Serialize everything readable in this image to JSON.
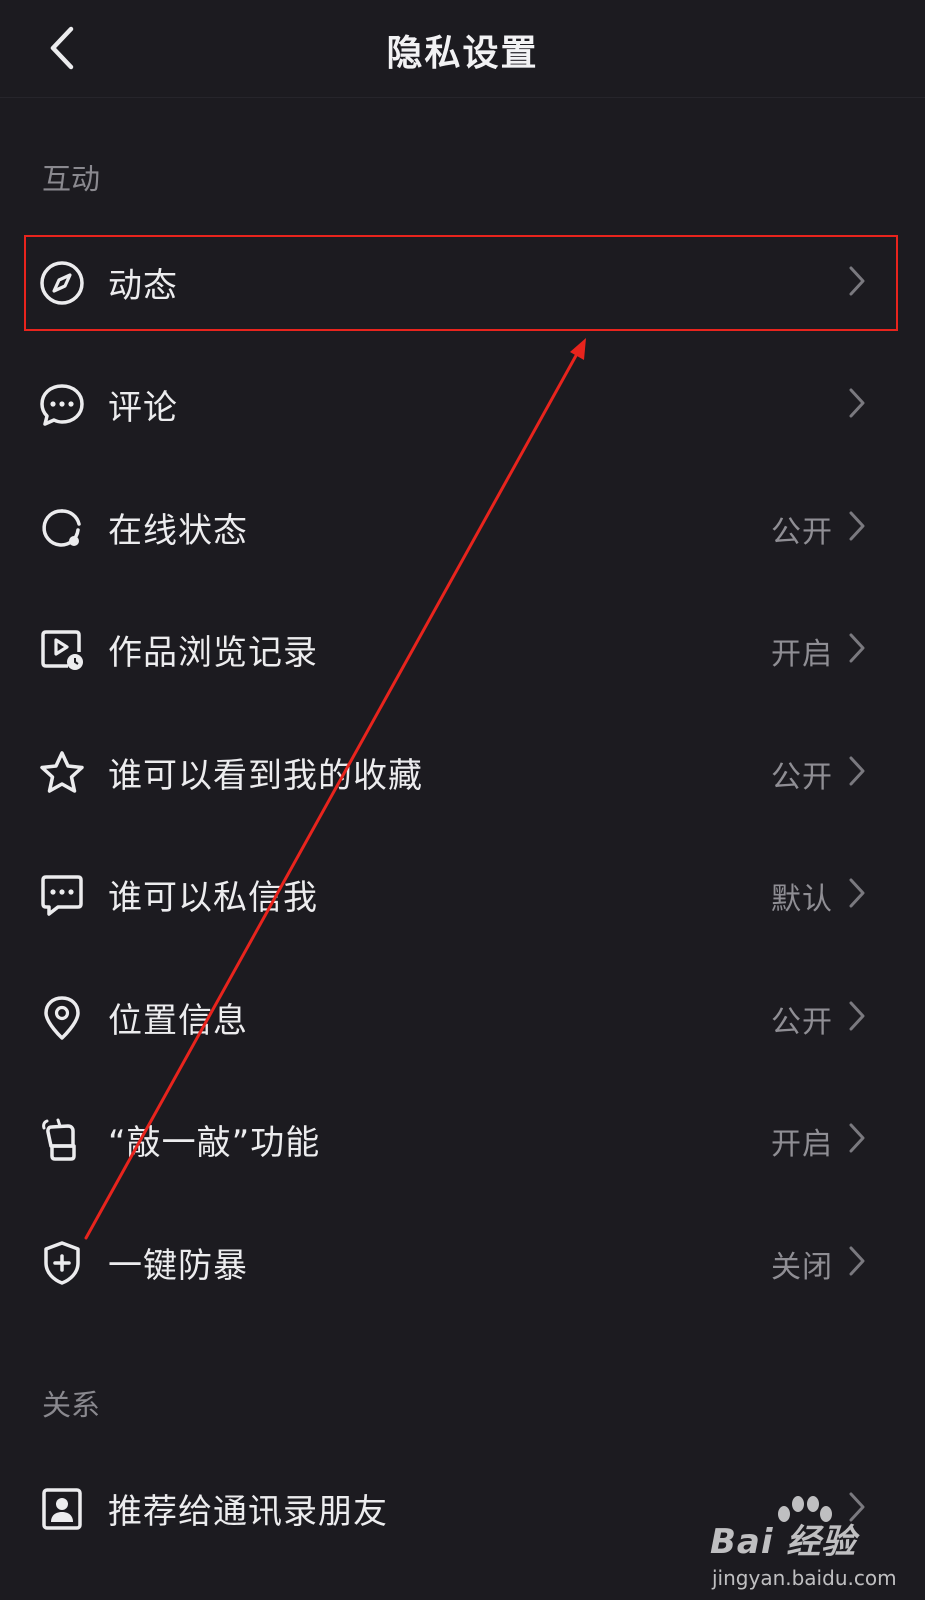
{
  "header": {
    "title": "隐私设置",
    "back_icon": "chevron-left-icon"
  },
  "sections": {
    "interaction": "互动",
    "relations": "关系"
  },
  "items": [
    {
      "icon": "compass-icon",
      "label": "动态",
      "value": ""
    },
    {
      "icon": "chat-bubble-icon",
      "label": "评论",
      "value": ""
    },
    {
      "icon": "online-status-icon",
      "label": "在线状态",
      "value": "公开"
    },
    {
      "icon": "video-history-icon",
      "label": "作品浏览记录",
      "value": "开启"
    },
    {
      "icon": "star-icon",
      "label": "谁可以看到我的收藏",
      "value": "公开"
    },
    {
      "icon": "message-icon",
      "label": "谁可以私信我",
      "value": "默认"
    },
    {
      "icon": "location-pin-icon",
      "label": "位置信息",
      "value": "公开"
    },
    {
      "icon": "knock-hand-icon",
      "label": "“敲一敲”功能",
      "value": "开启"
    },
    {
      "icon": "shield-plus-icon",
      "label": "一键防暴",
      "value": "关闭"
    },
    {
      "icon": "contact-card-icon",
      "label": "推荐给通讯录朋友",
      "value": ""
    }
  ],
  "watermark": {
    "brand": "Bai 经验",
    "url": "jingyan.baidu.com"
  },
  "colors": {
    "background": "#1c1b20",
    "text": "#ececee",
    "secondary_text": "#8f8e94",
    "annotation": "#e8241d"
  }
}
